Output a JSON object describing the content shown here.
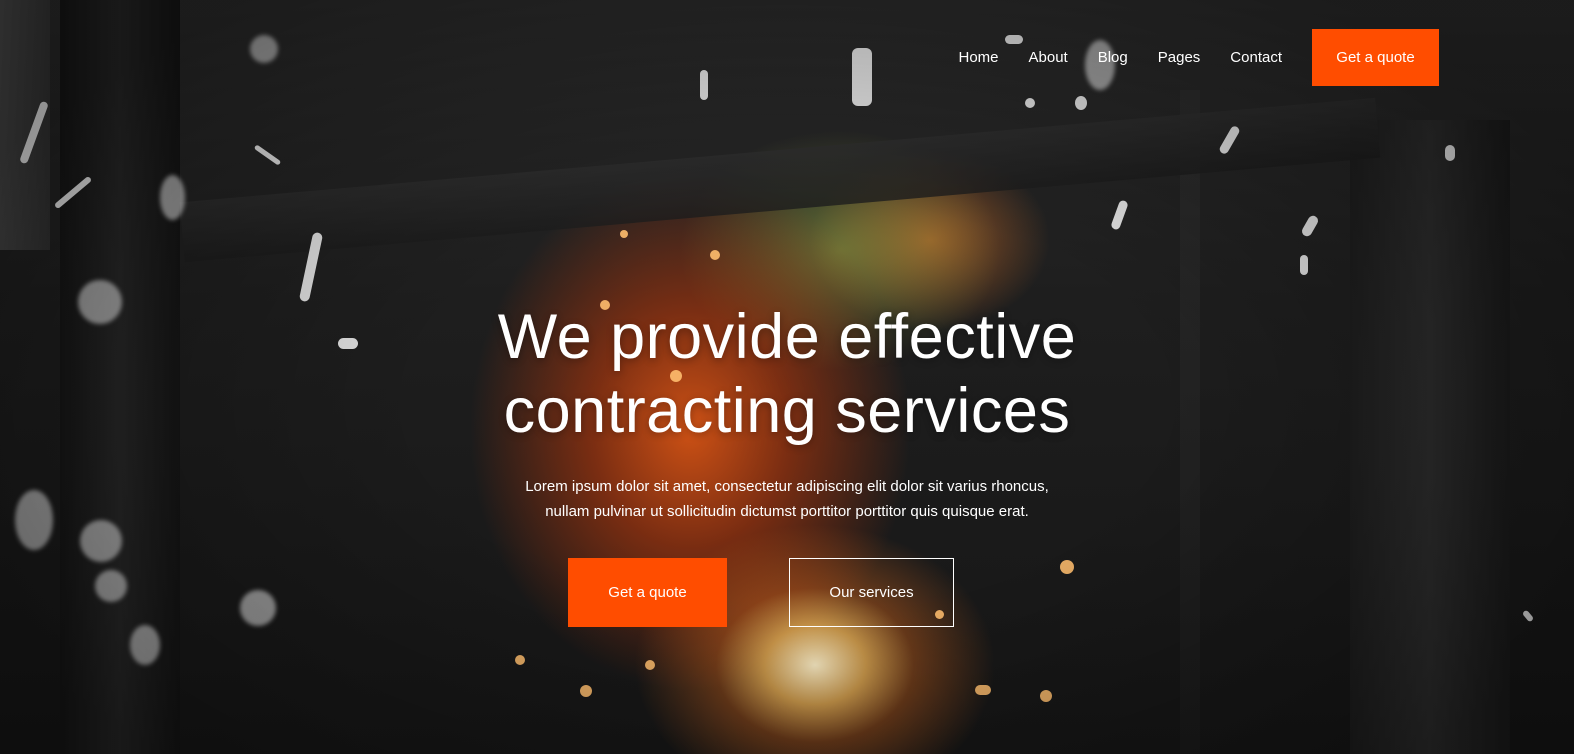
{
  "nav": {
    "items": [
      {
        "label": "Home"
      },
      {
        "label": "About"
      },
      {
        "label": "Blog"
      },
      {
        "label": "Pages"
      },
      {
        "label": "Contact"
      }
    ],
    "cta_label": "Get a quote"
  },
  "hero": {
    "headline_line1": "We provide effective",
    "headline_line2": "contracting services",
    "lead_line1": "Lorem ipsum dolor sit amet, consectetur adipiscing elit dolor sit varius rhoncus,",
    "lead_line2": "nullam pulvinar ut sollicitudin dictumst porttitor porttitor quis quisque erat.",
    "primary_button_label": "Get a quote",
    "secondary_button_label": "Our services"
  },
  "colors": {
    "accent": "#ff4d00",
    "text": "#ffffff",
    "background": "#1b1b1b"
  }
}
